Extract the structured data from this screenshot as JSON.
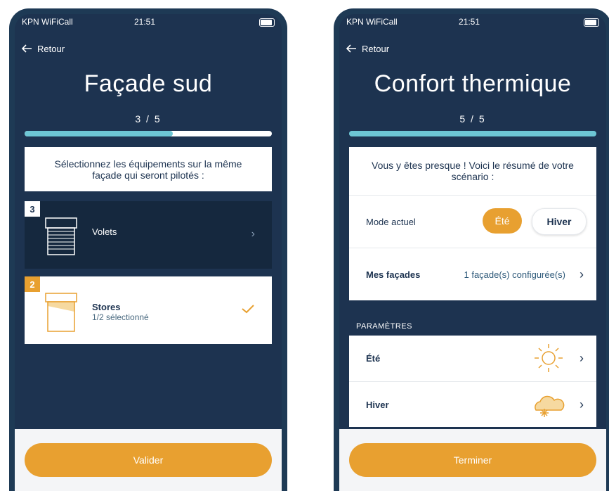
{
  "status": {
    "carrier": "KPN WiFiCall",
    "time": "21:51"
  },
  "colors": {
    "navy": "#1d3350",
    "accent": "#e8a030",
    "progress": "#6dc6d4"
  },
  "left": {
    "back_label": "Retour",
    "title": "Façade sud",
    "step": "3 / 5",
    "progress": 0.6,
    "instruction": "Sélectionnez les équipements sur la même façade qui seront pilotés :",
    "equipments": [
      {
        "badge": "3",
        "label": "Volets",
        "sub": "",
        "icon": "shutter-icon",
        "selected": false
      },
      {
        "badge": "2",
        "label": "Stores",
        "sub": "1/2 sélectionné",
        "icon": "blind-icon",
        "selected": true
      }
    ],
    "cta": "Valider"
  },
  "right": {
    "back_label": "Retour",
    "title": "Confort thermique",
    "step": "5 / 5",
    "progress": 1.0,
    "summary_head": "Vous y êtes presque ! Voici le résumé de votre scénario :",
    "mode_label": "Mode actuel",
    "mode_options": [
      "Été",
      "Hiver"
    ],
    "mode_selected": "Été",
    "facades_label": "Mes façades",
    "facades_value": "1 façade(s) configurée(s)",
    "params_label": "PARAMÈTRES",
    "params": [
      {
        "label": "Été",
        "icon": "sun-icon"
      },
      {
        "label": "Hiver",
        "icon": "snow-cloud-icon"
      }
    ],
    "cta": "Terminer"
  }
}
